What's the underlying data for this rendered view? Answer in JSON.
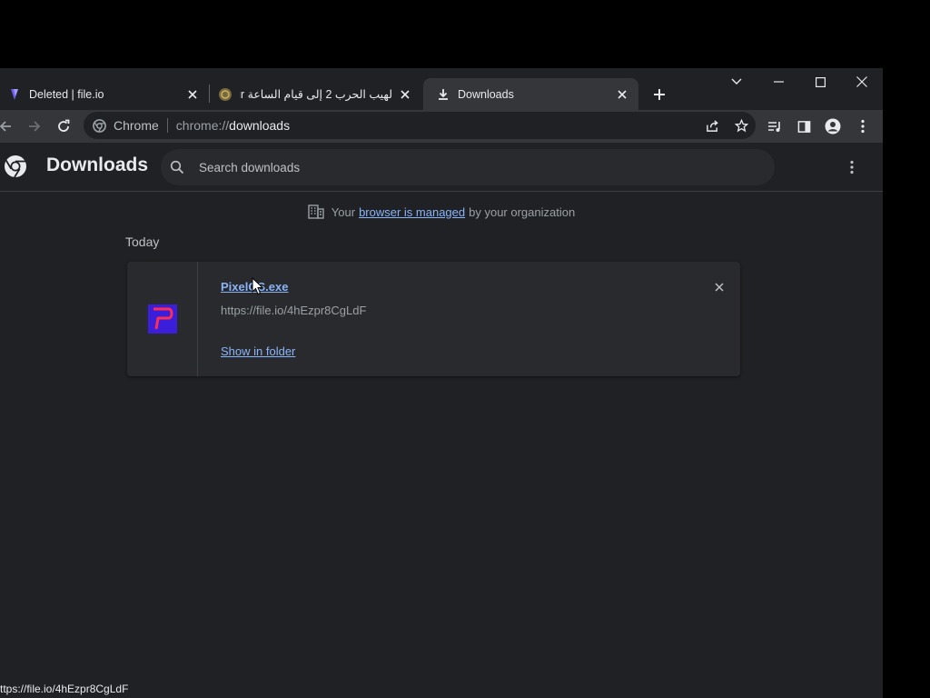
{
  "tabs": [
    {
      "title": "Deleted | file.io",
      "icon": "fileio-favicon-icon"
    },
    {
      "title": "لهيب الحرب 2 إلى قيام الساعة our",
      "icon": "globe-favicon-icon"
    },
    {
      "title": "Downloads",
      "icon": "download-icon",
      "active": true
    }
  ],
  "omnibox": {
    "chip_label": "Chrome",
    "url_scheme": "chrome://",
    "url_host": "downloads"
  },
  "page": {
    "title": "Downloads",
    "search_placeholder": "Search downloads",
    "managed_prefix": "Your",
    "managed_link": "browser is managed",
    "managed_suffix": "by your organization",
    "date_group": "Today"
  },
  "download": {
    "filename": "PixelOS.exe",
    "url": "https://file.io/4hEzpr8CgLdF",
    "action": "Show in folder"
  },
  "status_bar": "ttps://file.io/4hEzpr8CgLdF",
  "colors": {
    "background": "#202124",
    "toolbar": "#35363a",
    "link": "#8ab4f8",
    "card": "#292a2d"
  }
}
